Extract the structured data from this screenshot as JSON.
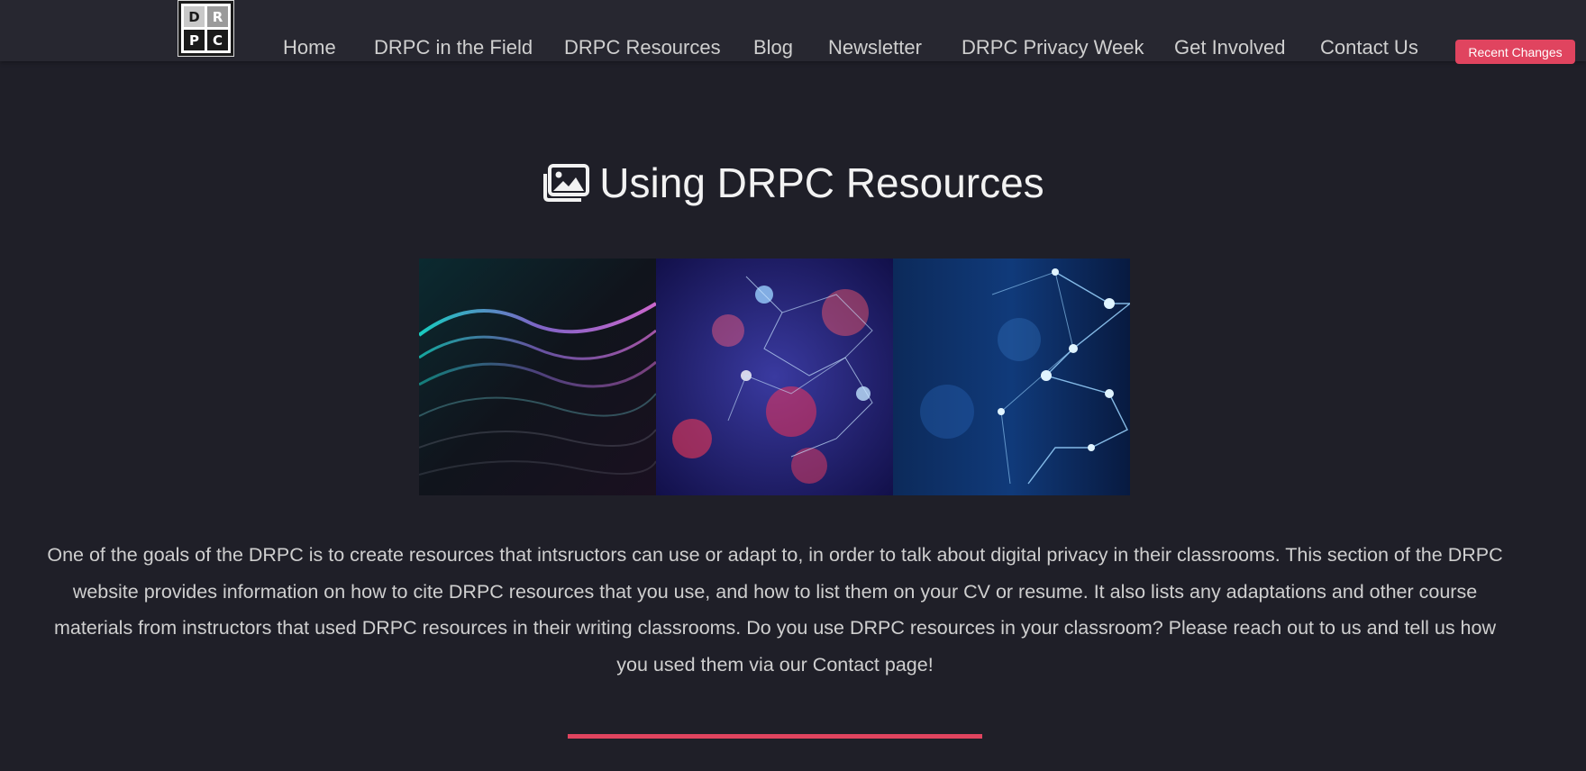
{
  "logo": {
    "letters": [
      "D",
      "R",
      "P",
      "C"
    ]
  },
  "nav": {
    "items": [
      {
        "label": "Home"
      },
      {
        "label": "DRPC in the Field"
      },
      {
        "label": "DRPC Resources"
      },
      {
        "label": "Blog"
      },
      {
        "label": "Newsletter"
      },
      {
        "label": "DRPC Privacy Week"
      },
      {
        "label": "Get Involved"
      },
      {
        "label": "Contact Us"
      }
    ],
    "recent_changes_label": "Recent Changes"
  },
  "page": {
    "title": "Using DRPC Resources",
    "title_icon": "images-icon",
    "hero_images": [
      "data-wave-image",
      "network-bokeh-image",
      "blue-network-image"
    ],
    "body": "One of the goals of the DRPC is to create resources that intsructors can use or adapt to, in order to talk about digital privacy in their classrooms. This section of the DRPC website provides information on how to cite DRPC resources that you use, and how to list them on your CV or resume. It also lists any adaptations and other course materials from instructors that used DRPC resources in their writing classrooms. Do you use DRPC resources in your classroom? Please reach out to us and tell us how you used them via our Contact page!"
  },
  "colors": {
    "background": "#1f1f28",
    "topbar": "#272730",
    "accent": "#e0445f",
    "text": "#cfcfcf"
  }
}
